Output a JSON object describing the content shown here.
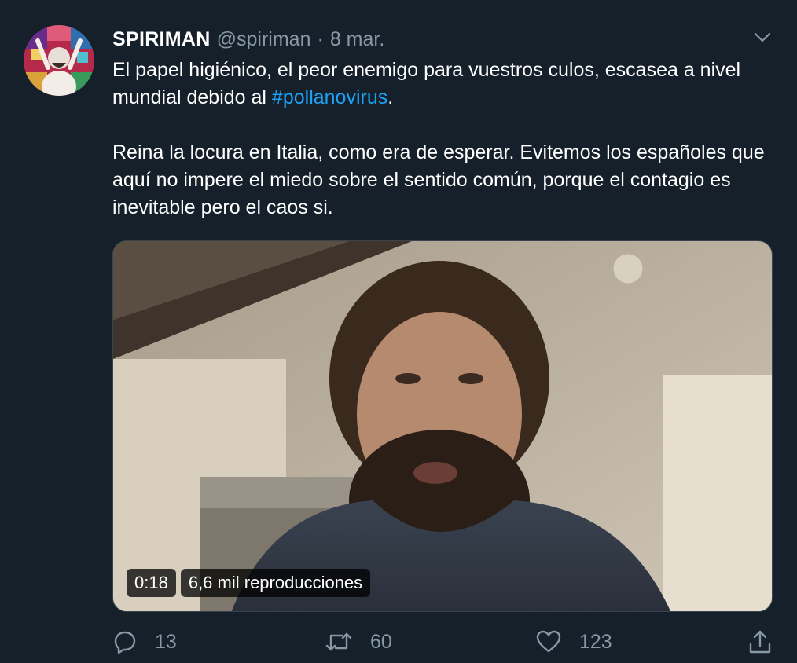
{
  "tweet": {
    "author_name": "SPIRIMAN",
    "handle": "@spiriman",
    "separator": "·",
    "date": "8 mar.",
    "text_line1_before": "El papel higiénico, el peor enemigo para vuestros culos, escasea a nivel mundial debido al ",
    "hashtag": "#pollanovirus",
    "text_line1_after": ".",
    "paragraph2": "Reina la locura en Italia, como era de esperar. Evitemos los españoles que aquí no impere el miedo sobre el sentido común, porque el contagio es inevitable pero el caos si."
  },
  "video": {
    "duration": "0:18",
    "views": "6,6 mil reproducciones"
  },
  "actions": {
    "reply_count": "13",
    "retweet_count": "60",
    "like_count": "123"
  },
  "icons": {
    "caret": "chevron-down-icon",
    "reply": "reply-icon",
    "retweet": "retweet-icon",
    "like": "heart-icon",
    "share": "share-icon"
  },
  "colors": {
    "background": "#15202b",
    "text": "#ffffff",
    "secondary": "#8899a6",
    "link": "#1da1f2"
  }
}
